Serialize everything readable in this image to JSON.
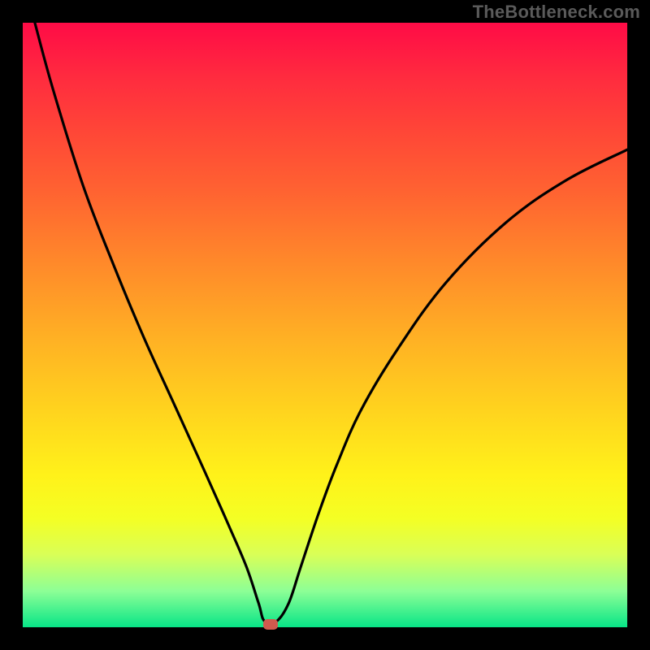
{
  "watermark": {
    "text": "TheBottleneck.com"
  },
  "chart_data": {
    "type": "line",
    "title": "",
    "xlabel": "",
    "ylabel": "",
    "xlim": [
      0,
      100
    ],
    "ylim": [
      0,
      100
    ],
    "grid": false,
    "marker": {
      "x": 41,
      "y": 0,
      "color": "#cf5a4e"
    },
    "series": [
      {
        "name": "curve",
        "x": [
          2,
          5,
          10,
          15,
          20,
          25,
          30,
          34,
          37,
          39,
          40,
          42,
          44,
          46,
          49,
          52,
          56,
          62,
          70,
          80,
          90,
          100
        ],
        "values": [
          100,
          89,
          73,
          60,
          48,
          37,
          26,
          17,
          10,
          4,
          1,
          1,
          4,
          10,
          19,
          27,
          36,
          46,
          57,
          67,
          74,
          79
        ]
      }
    ],
    "colors": {
      "gradient_top": "#ff0b46",
      "gradient_bottom": "#07e587",
      "line": "#000000",
      "frame": "#000000"
    }
  }
}
